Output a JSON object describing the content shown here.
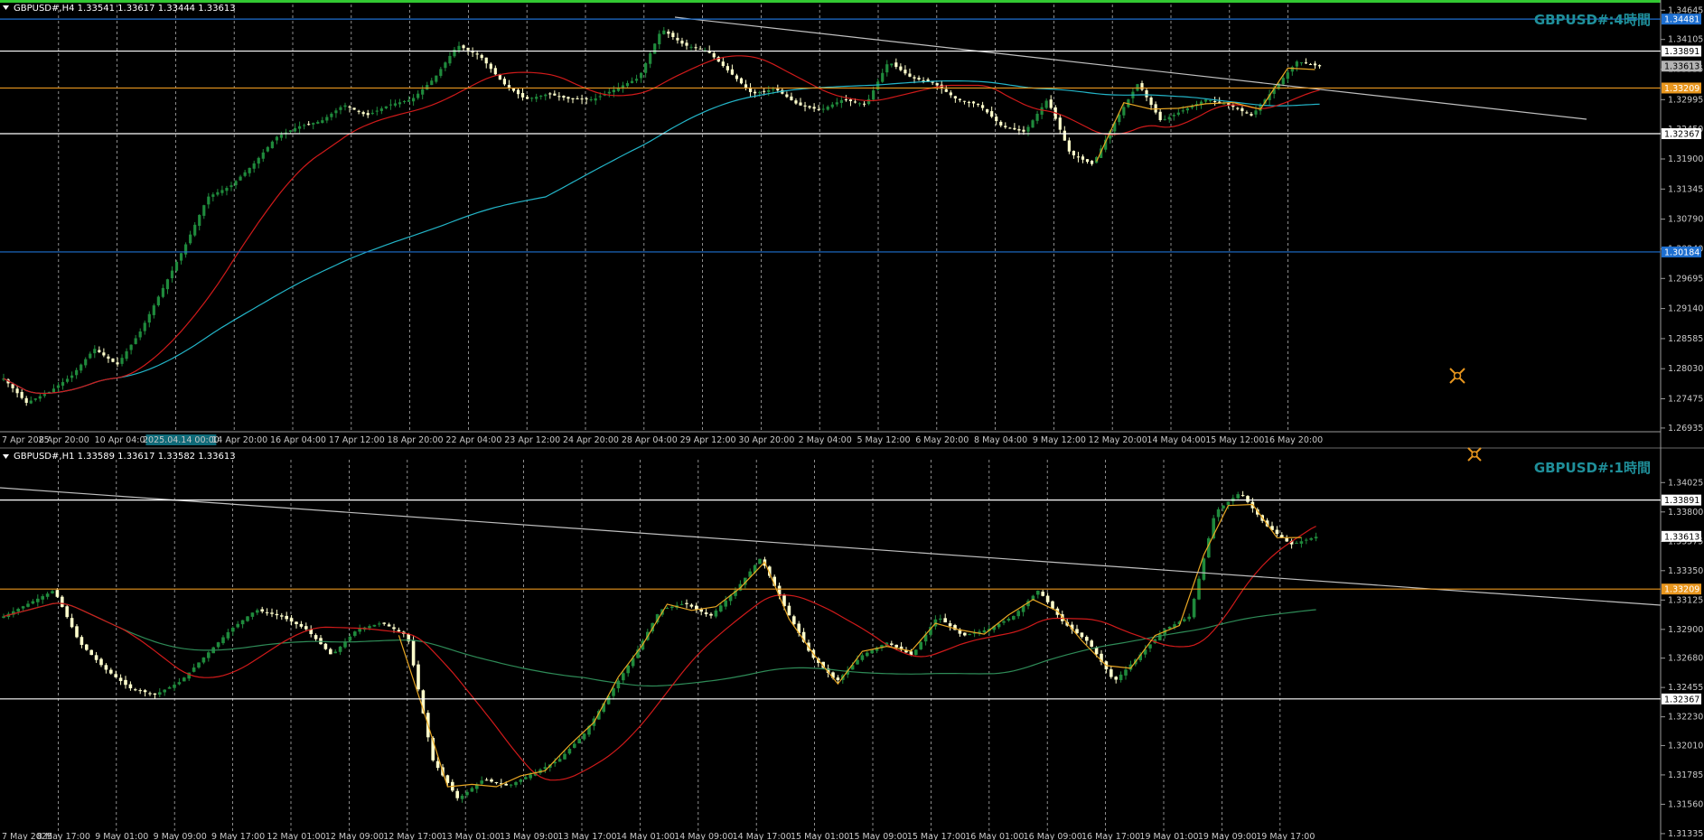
{
  "window": {
    "panel_h4": {
      "info": "GBPUSD#,H4  1.33541 1.33617 1.33444 1.33613",
      "title": "GBPUSD#:4時間",
      "yticks": [
        "1.34645",
        "1.34105",
        "1.33555",
        "1.32995",
        "1.32450",
        "1.31900",
        "1.31345",
        "1.30790",
        "1.30240",
        "1.29695",
        "1.29140",
        "1.28585",
        "1.28030",
        "1.27475",
        "1.26935"
      ],
      "xticks": [
        "7 Apr 2025",
        "8 Apr 20:00",
        "10 Apr 04:00",
        "2025.04.14 00:00",
        "14 Apr 20:00",
        "16 Apr 04:00",
        "17 Apr 12:00",
        "18 Apr 20:00",
        "22 Apr 04:00",
        "23 Apr 12:00",
        "24 Apr 20:00",
        "28 Apr 04:00",
        "29 Apr 12:00",
        "30 Apr 20:00",
        "2 May 04:00",
        "5 May 12:00",
        "6 May 20:00",
        "8 May 04:00",
        "9 May 12:00",
        "12 May 20:00",
        "14 May 04:00",
        "15 May 12:00",
        "16 May 20:00"
      ],
      "price_labels": [
        {
          "text": "1.34481",
          "color": "#1e6fd0"
        },
        {
          "text": "1.33891",
          "color": "#ffffff"
        },
        {
          "text": "1.33613",
          "color": "#b4b4b4"
        },
        {
          "text": "1.33209",
          "color": "#e8961e"
        },
        {
          "text": "1.32367",
          "color": "#ffffff"
        },
        {
          "text": "1.30184",
          "color": "#1e6fd0"
        }
      ]
    },
    "panel_h1": {
      "info": "GBPUSD#,H1  1.33589 1.33617 1.33582 1.33613",
      "title": "GBPUSD#:1時間",
      "yticks": [
        "1.34025",
        "1.33800",
        "1.33575",
        "1.33350",
        "1.33125",
        "1.32900",
        "1.32680",
        "1.32455",
        "1.32230",
        "1.32010",
        "1.31785",
        "1.31560",
        "1.31335"
      ],
      "xticks": [
        "7 May 2025",
        "8 May 17:00",
        "9 May 01:00",
        "9 May 09:00",
        "9 May 17:00",
        "12 May 01:00",
        "12 May 09:00",
        "12 May 17:00",
        "13 May 01:00",
        "13 May 09:00",
        "13 May 17:00",
        "14 May 01:00",
        "14 May 09:00",
        "14 May 17:00",
        "15 May 01:00",
        "15 May 09:00",
        "15 May 17:00",
        "16 May 01:00",
        "16 May 09:00",
        "16 May 17:00",
        "19 May 01:00",
        "19 May 09:00",
        "19 May 17:00"
      ],
      "price_labels": [
        {
          "text": "1.33891",
          "color": "#ffffff"
        },
        {
          "text": "1.33613",
          "color": "#ffffff"
        },
        {
          "text": "1.33209",
          "color": "#e8961e"
        },
        {
          "text": "1.32367",
          "color": "#ffffff"
        }
      ]
    }
  },
  "colors": {
    "background": "#000000",
    "bull": "#1f8a3c",
    "bear": "#ffffcc",
    "ma_short": "#d01a1a",
    "ma_long_h4": "#23b5c8",
    "ma_long_h1": "#2e8b57",
    "zigzag": "#e8a623",
    "trendline": "#c0c0c0",
    "grid": "#b0b0b0"
  },
  "chart_data": [
    {
      "type": "candlestick",
      "title": "GBPUSD#:4時間",
      "symbol": "GBPUSD#",
      "timeframe": "H4",
      "ohlc_last": {
        "open": 1.33541,
        "high": 1.33617,
        "low": 1.33444,
        "close": 1.33613
      },
      "ylim": [
        1.269,
        1.3475
      ],
      "x_categories": [
        "7 Apr 2025",
        "8 Apr 20:00",
        "10 Apr 04:00",
        "2025.04.14 00:00",
        "14 Apr 20:00",
        "16 Apr 04:00",
        "17 Apr 12:00",
        "18 Apr 20:00",
        "22 Apr 04:00",
        "23 Apr 12:00",
        "24 Apr 20:00",
        "28 Apr 04:00",
        "29 Apr 12:00",
        "30 Apr 20:00",
        "2 May 04:00",
        "5 May 12:00",
        "6 May 20:00",
        "8 May 04:00",
        "9 May 12:00",
        "12 May 20:00",
        "14 May 04:00",
        "15 May 12:00",
        "16 May 20:00"
      ],
      "close_path": [
        1.2785,
        1.274,
        1.276,
        1.279,
        1.284,
        1.281,
        1.287,
        1.295,
        1.303,
        1.312,
        1.314,
        1.318,
        1.323,
        1.325,
        1.326,
        1.329,
        1.327,
        1.329,
        1.33,
        1.334,
        1.34,
        1.338,
        1.333,
        1.33,
        1.331,
        1.33,
        1.33,
        1.332,
        1.334,
        1.343,
        1.34,
        1.339,
        1.335,
        1.331,
        1.332,
        1.329,
        1.328,
        1.33,
        1.329,
        1.337,
        1.334,
        1.333,
        1.33,
        1.329,
        1.325,
        1.324,
        1.33,
        1.32,
        1.318,
        1.326,
        1.333,
        1.326,
        1.328,
        1.33,
        1.329,
        1.327,
        1.332,
        1.337,
        1.3361
      ],
      "horizontal_levels": [
        1.34481,
        1.33891,
        1.33209,
        1.32367,
        1.30184
      ],
      "series": [
        {
          "name": "MA short",
          "color": "#d01a1a"
        },
        {
          "name": "MA long",
          "color": "#23b5c8"
        }
      ]
    },
    {
      "type": "candlestick",
      "title": "GBPUSD#:1時間",
      "symbol": "GBPUSD#",
      "timeframe": "H1",
      "ohlc_last": {
        "open": 1.33589,
        "high": 1.33617,
        "low": 1.33582,
        "close": 1.33613
      },
      "ylim": [
        1.313,
        1.342
      ],
      "x_categories": [
        "7 May 2025",
        "8 May 17:00",
        "9 May 01:00",
        "9 May 09:00",
        "9 May 17:00",
        "12 May 01:00",
        "12 May 09:00",
        "12 May 17:00",
        "13 May 01:00",
        "13 May 09:00",
        "13 May 17:00",
        "14 May 01:00",
        "14 May 09:00",
        "14 May 17:00",
        "15 May 01:00",
        "15 May 09:00",
        "15 May 17:00",
        "16 May 01:00",
        "16 May 09:00",
        "16 May 17:00",
        "19 May 01:00",
        "19 May 09:00",
        "19 May 17:00"
      ],
      "close_path": [
        1.33,
        1.331,
        1.332,
        1.328,
        1.326,
        1.3245,
        1.324,
        1.325,
        1.327,
        1.329,
        1.3305,
        1.33,
        1.329,
        1.327,
        1.329,
        1.3295,
        1.3285,
        1.319,
        1.316,
        1.3175,
        1.317,
        1.318,
        1.319,
        1.321,
        1.324,
        1.327,
        1.3305,
        1.331,
        1.33,
        1.332,
        1.3345,
        1.3305,
        1.327,
        1.325,
        1.327,
        1.328,
        1.327,
        1.33,
        1.3285,
        1.329,
        1.33,
        1.332,
        1.3295,
        1.328,
        1.325,
        1.327,
        1.329,
        1.33,
        1.338,
        1.3395,
        1.337,
        1.3355,
        1.3361
      ],
      "horizontal_levels": [
        1.33891,
        1.33209,
        1.32367
      ],
      "series": [
        {
          "name": "MA short",
          "color": "#d01a1a"
        },
        {
          "name": "MA long",
          "color": "#2e8b57"
        }
      ]
    }
  ]
}
